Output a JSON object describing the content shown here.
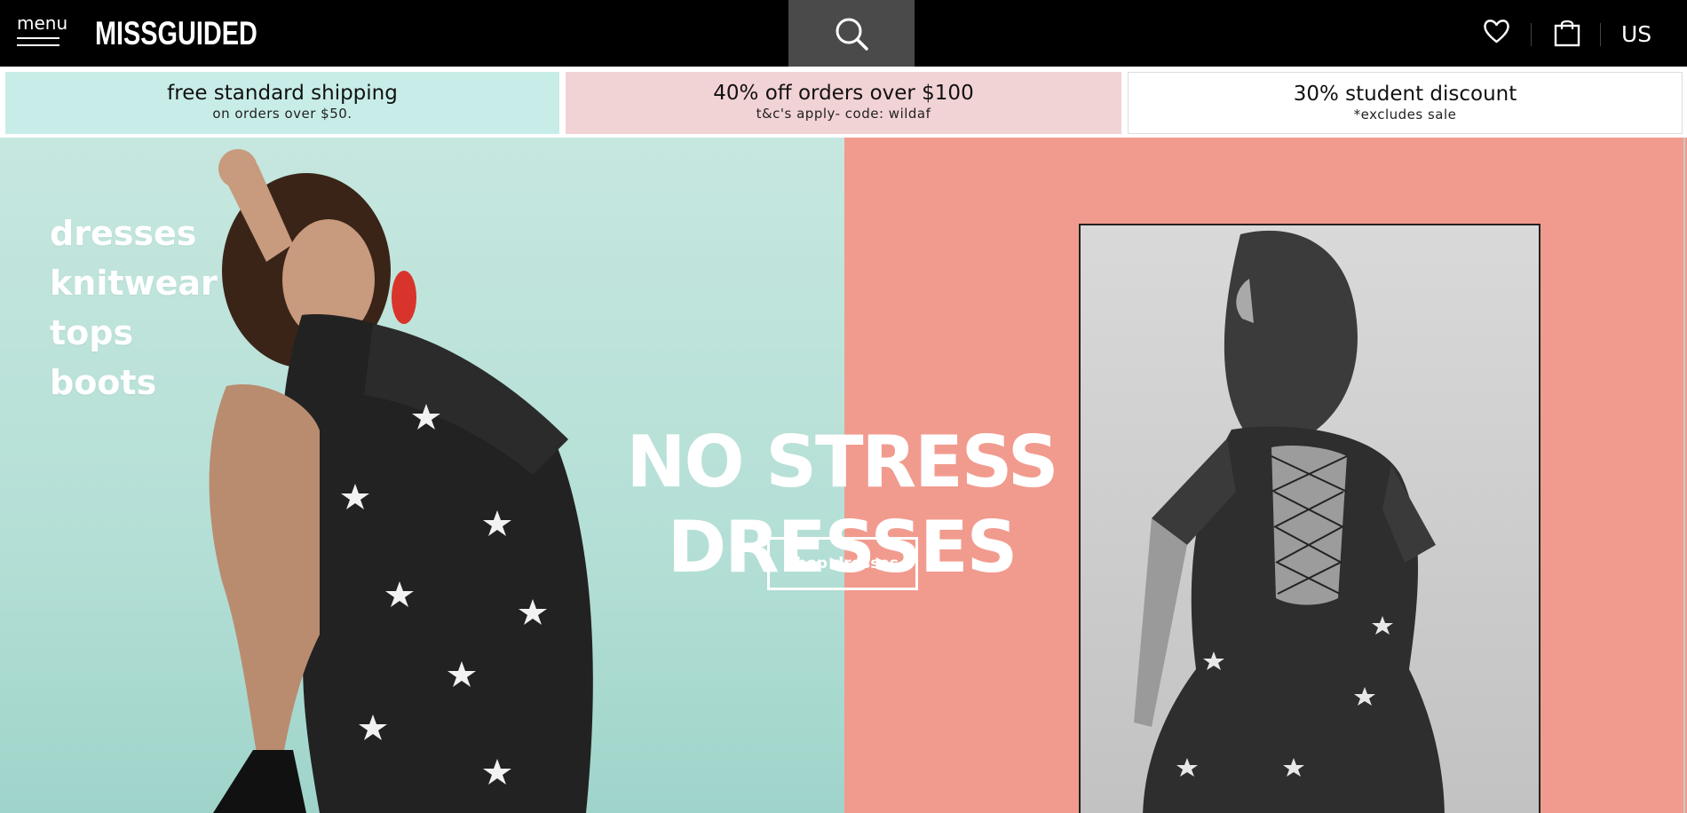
{
  "header": {
    "menu_label": "menu",
    "logo": "MISSGUIDED",
    "country": "US",
    "icons": {
      "menu": "hamburger-icon",
      "search": "search-icon",
      "wishlist": "heart-icon",
      "bag": "shopping-bag-icon"
    },
    "colors": {
      "background": "#000000",
      "search_bg": "#4a4a4a"
    }
  },
  "promos": [
    {
      "title": "free standard shipping",
      "subtitle": "on orders over $50.",
      "color": "#c8ede8"
    },
    {
      "title": "40% off orders over $100",
      "subtitle": "t&c's apply- code: wildaf",
      "color": "#f2d3d5"
    },
    {
      "title": "30% student discount",
      "subtitle": "*excludes sale",
      "color": "#ffffff"
    }
  ],
  "hero": {
    "categories": [
      "dresses",
      "knitwear",
      "tops",
      "boots"
    ],
    "headline": "NO STRESS DRESSES",
    "cta": "shop dresses",
    "colors": {
      "left": "#b4dfd6",
      "right": "#f19b8e"
    }
  }
}
